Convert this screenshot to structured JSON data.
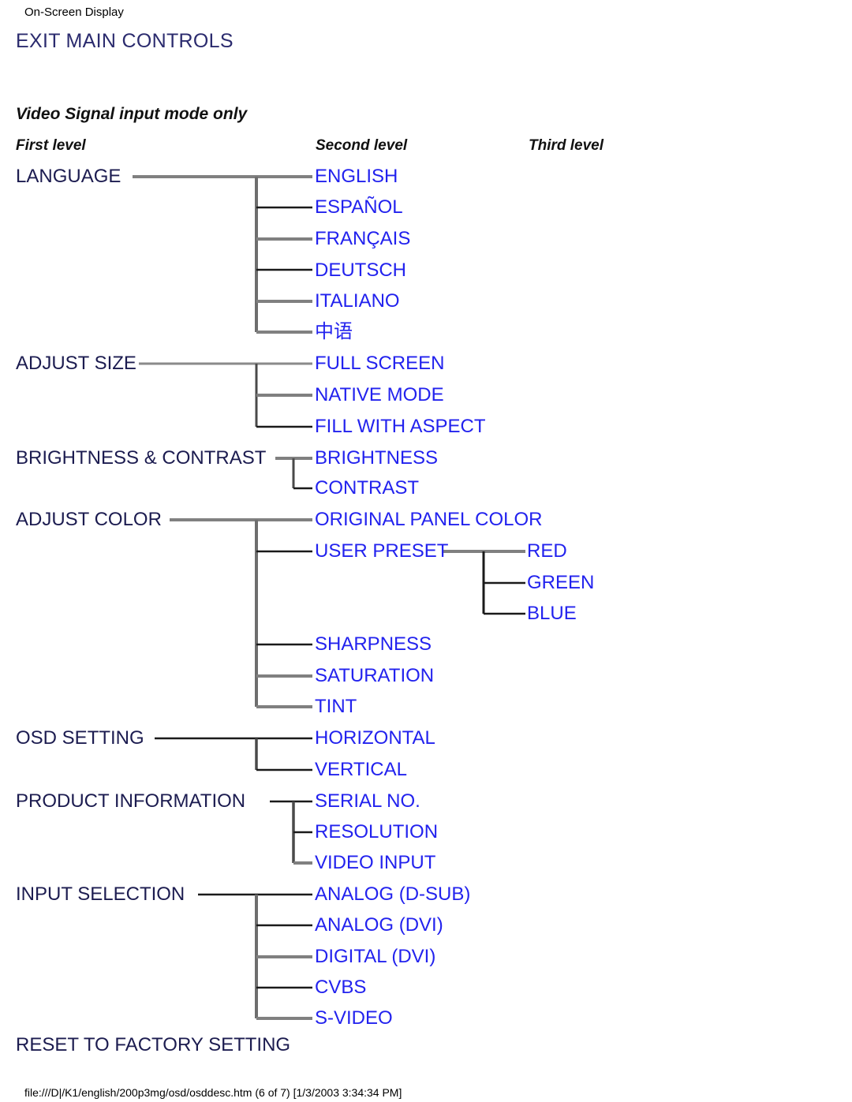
{
  "document": {
    "title": "On-Screen Display",
    "heading": "EXIT MAIN CONTROLS",
    "subtitle": "Video Signal input mode only",
    "footer_path": "file:///D|/K1/english/200p3mg/osd/osddesc.htm (6 of 7) [1/3/2003 3:34:34 PM]"
  },
  "columns": {
    "first": "First level",
    "second": "Second level",
    "third": "Third level"
  },
  "colors": {
    "heading": "#2b2b6e",
    "level1_text": "#1c1c50",
    "level2_text": "#2222ee",
    "level3_text": "#2222ee",
    "connector_gray": "#808080",
    "connector_dark": "#1a1a1a",
    "page_background": "#ffffff"
  },
  "menu": [
    {
      "label": "LANGUAGE",
      "children": [
        {
          "label": "ENGLISH"
        },
        {
          "label": "ESPAÑOL"
        },
        {
          "label": "FRANÇAIS"
        },
        {
          "label": "DEUTSCH"
        },
        {
          "label": "ITALIANO"
        },
        {
          "label": "中语"
        }
      ]
    },
    {
      "label": "ADJUST SIZE",
      "children": [
        {
          "label": "FULL SCREEN"
        },
        {
          "label": "NATIVE MODE"
        },
        {
          "label": "FILL WITH ASPECT"
        }
      ]
    },
    {
      "label": "BRIGHTNESS & CONTRAST",
      "children": [
        {
          "label": "BRIGHTNESS"
        },
        {
          "label": "CONTRAST"
        }
      ]
    },
    {
      "label": "ADJUST COLOR",
      "children": [
        {
          "label": "ORIGINAL PANEL COLOR"
        },
        {
          "label": "USER PRESET",
          "children": [
            {
              "label": "RED"
            },
            {
              "label": "GREEN"
            },
            {
              "label": "BLUE"
            }
          ]
        },
        {
          "label": "SHARPNESS"
        },
        {
          "label": "SATURATION"
        },
        {
          "label": "TINT"
        }
      ]
    },
    {
      "label": "OSD SETTING",
      "children": [
        {
          "label": "HORIZONTAL"
        },
        {
          "label": "VERTICAL"
        }
      ]
    },
    {
      "label": "PRODUCT INFORMATION",
      "children": [
        {
          "label": "SERIAL NO."
        },
        {
          "label": "RESOLUTION"
        },
        {
          "label": "VIDEO INPUT"
        }
      ]
    },
    {
      "label": "INPUT SELECTION",
      "children": [
        {
          "label": "ANALOG (D-SUB)"
        },
        {
          "label": "ANALOG (DVI)"
        },
        {
          "label": "DIGITAL (DVI)"
        },
        {
          "label": "CVBS"
        },
        {
          "label": "S-VIDEO"
        }
      ]
    },
    {
      "label": "RESET TO FACTORY SETTING",
      "children": []
    }
  ],
  "nodes": {
    "language": "LANGUAGE",
    "english": "ENGLISH",
    "espanol": "ESPAÑOL",
    "francais": "FRANÇAIS",
    "deutsch": "DEUTSCH",
    "italiano": "ITALIANO",
    "chinese": "中语",
    "adjust_size": "ADJUST SIZE",
    "full_screen": "FULL SCREEN",
    "native_mode": "NATIVE MODE",
    "fill_with_aspect": "FILL WITH ASPECT",
    "brightness_contrast": "BRIGHTNESS & CONTRAST",
    "brightness": "BRIGHTNESS",
    "contrast": "CONTRAST",
    "adjust_color": "ADJUST COLOR",
    "original_panel_color": "ORIGINAL PANEL COLOR",
    "user_preset": "USER PRESET",
    "red": "RED",
    "green": "GREEN",
    "blue": "BLUE",
    "sharpness": "SHARPNESS",
    "saturation": "SATURATION",
    "tint": "TINT",
    "osd_setting": "OSD SETTING",
    "horizontal": "HORIZONTAL",
    "vertical": "VERTICAL",
    "product_information": "PRODUCT INFORMATION",
    "serial_no": "SERIAL NO.",
    "resolution": "RESOLUTION",
    "video_input": "VIDEO INPUT",
    "input_selection": "INPUT SELECTION",
    "analog_dsub": "ANALOG (D-SUB)",
    "analog_dvi": "ANALOG (DVI)",
    "digital_dvi": "DIGITAL (DVI)",
    "cvbs": "CVBS",
    "svideo": "S-VIDEO",
    "reset_to_factory_setting": "RESET TO FACTORY SETTING"
  }
}
